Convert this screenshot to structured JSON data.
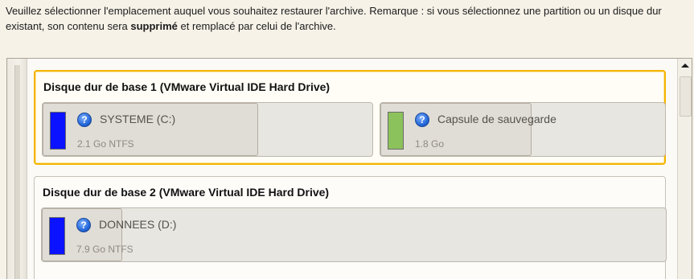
{
  "instructions": {
    "before_bold": "Veuillez sélectionner l'emplacement auquel vous souhaitez restaurer l'archive. Remarque : si vous sélectionnez une partition ou un disque dur existant, son contenu sera ",
    "bold": "supprimé",
    "after_bold": " et remplacé par celui de l'archive."
  },
  "disks": [
    {
      "title": "Disque dur de base 1 (VMware Virtual IDE Hard Drive)",
      "selected": true,
      "partitions": [
        {
          "name": "SYSTEME (C:)",
          "info": "2.1 Go NTFS",
          "color": "#0a12ff",
          "icon": "help-icon"
        },
        {
          "name": "Capsule de sauvegarde",
          "info": "1.8 Go",
          "color": "#8cc25b",
          "icon": "help-icon"
        }
      ]
    },
    {
      "title": "Disque dur de base 2 (VMware Virtual IDE Hard Drive)",
      "selected": false,
      "partitions": [
        {
          "name": "DONNEES (D:)",
          "info": "7.9 Go NTFS",
          "color": "#0a12ff",
          "icon": "help-icon"
        }
      ]
    }
  ],
  "colors": {
    "selection_border": "#f4b400",
    "primary_partition": "#0a12ff",
    "backup_capsule": "#8cc25b"
  },
  "help_glyph": "?"
}
